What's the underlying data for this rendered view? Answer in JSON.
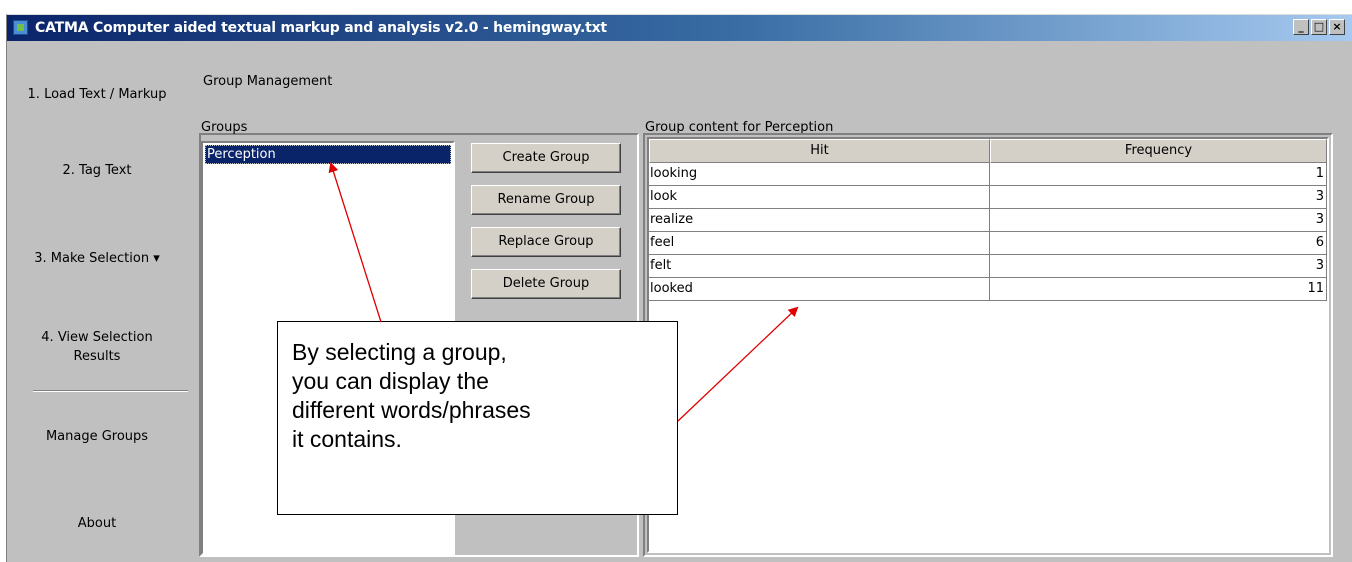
{
  "window": {
    "title": "CATMA Computer aided textual markup and analysis v2.0  - hemingway.txt",
    "controls": {
      "minimize": "_",
      "maximize": "□",
      "close": "×"
    }
  },
  "nav": {
    "load": "1. Load Text / Markup",
    "tag": "2. Tag Text",
    "selection": "3. Make Selection ▾",
    "view_results_line1": "4. View Selection",
    "view_results_line2": "Results",
    "manage_groups": "Manage Groups",
    "about": "About"
  },
  "page": {
    "title": "Group Management"
  },
  "groups": {
    "label": "Groups",
    "items": [
      "Perception"
    ],
    "selected": "Perception"
  },
  "buttons": {
    "create": "Create Group",
    "rename": "Rename Group",
    "replace": "Replace Group",
    "delete": "Delete Group"
  },
  "group_content": {
    "label": "Group content for Perception",
    "columns": {
      "hit": "Hit",
      "frequency": "Frequency"
    },
    "rows": [
      {
        "hit": "looking",
        "frequency": "1"
      },
      {
        "hit": "look",
        "frequency": "3"
      },
      {
        "hit": "realize",
        "frequency": "3"
      },
      {
        "hit": "feel",
        "frequency": "6"
      },
      {
        "hit": "felt",
        "frequency": "3"
      },
      {
        "hit": "looked",
        "frequency": "11"
      }
    ]
  },
  "annotation": {
    "line1": "By selecting a group,",
    "line2": "you can display the",
    "line3": "different words/phrases",
    "line4": "it contains.",
    "arrow_color": "#e00000"
  }
}
